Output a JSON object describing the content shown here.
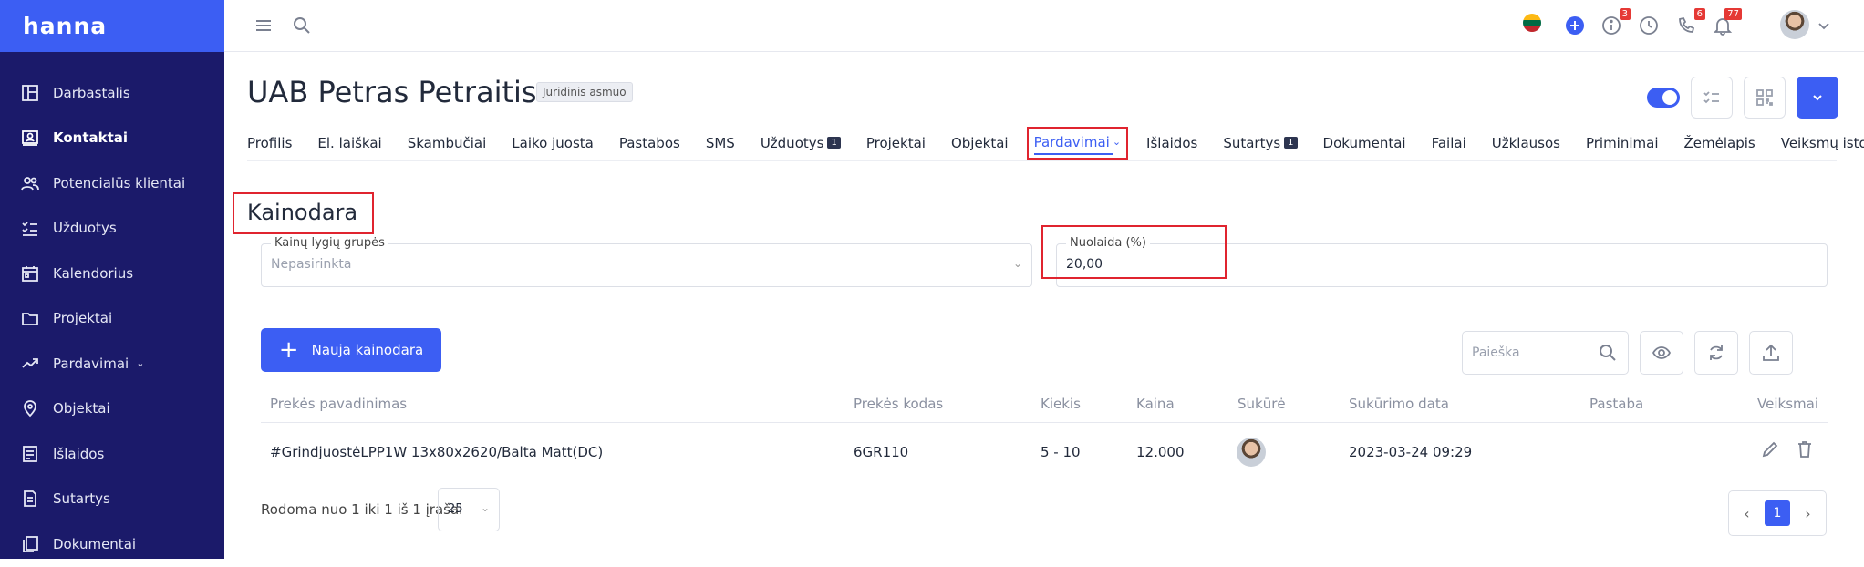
{
  "app": {
    "logo": "hanna"
  },
  "sidebar": {
    "items": [
      {
        "label": "Darbastalis",
        "icon": "dashboard-icon"
      },
      {
        "label": "Kontaktai",
        "icon": "contacts-icon"
      },
      {
        "label": "Potencialūs klientai",
        "icon": "leads-icon"
      },
      {
        "label": "Užduotys",
        "icon": "tasks-icon"
      },
      {
        "label": "Kalendorius",
        "icon": "calendar-icon"
      },
      {
        "label": "Projektai",
        "icon": "folder-icon"
      },
      {
        "label": "Pardavimai",
        "icon": "sales-icon"
      },
      {
        "label": "Objektai",
        "icon": "location-icon"
      },
      {
        "label": "Išlaidos",
        "icon": "expenses-icon"
      },
      {
        "label": "Sutartys",
        "icon": "contracts-icon"
      },
      {
        "label": "Dokumentai",
        "icon": "documents-icon"
      }
    ]
  },
  "topbar": {
    "badges": {
      "info": "3",
      "phone": "6",
      "notifications": "77"
    }
  },
  "header": {
    "title": "UAB Petras Petraitis",
    "type_badge": "Juridinis asmuo"
  },
  "tabs": [
    {
      "label": "Profilis"
    },
    {
      "label": "El. laiškai"
    },
    {
      "label": "Skambučiai"
    },
    {
      "label": "Laiko juosta"
    },
    {
      "label": "Pastabos"
    },
    {
      "label": "SMS"
    },
    {
      "label": "Užduotys",
      "count": "1"
    },
    {
      "label": "Projektai"
    },
    {
      "label": "Objektai"
    },
    {
      "label": "Pardavimai"
    },
    {
      "label": "Išlaidos"
    },
    {
      "label": "Sutartys",
      "count": "1"
    },
    {
      "label": "Dokumentai"
    },
    {
      "label": "Failai"
    },
    {
      "label": "Užklausos"
    },
    {
      "label": "Priminimai"
    },
    {
      "label": "Žemėlapis"
    },
    {
      "label": "Veiksmų istorija"
    }
  ],
  "section": {
    "title": "Kainodara",
    "price_group": {
      "label": "Kainų lygių grupės",
      "value": "Nepasirinkta"
    },
    "discount": {
      "label": "Nuolaida (%)",
      "value": "20,00"
    },
    "new_button": "Nauja kainodara",
    "search_placeholder": "Paieška"
  },
  "table": {
    "headers": [
      "Prekės pavadinimas",
      "Prekės kodas",
      "Kiekis",
      "Kaina",
      "Sukūrė",
      "Sukūrimo data",
      "Pastaba",
      "Veiksmai"
    ],
    "rows": [
      {
        "name": "#GrindjuostėLPP1W 13x80x2620/Balta Matt(DC)",
        "code": "6GR110",
        "qty": "5 - 10",
        "price": "12.000",
        "created": "2023-03-24 09:29",
        "note": ""
      }
    ]
  },
  "footer": {
    "showing": "Rodoma nuo 1 iki 1 iš 1 įrašai",
    "per_page": "25",
    "page": "1"
  }
}
